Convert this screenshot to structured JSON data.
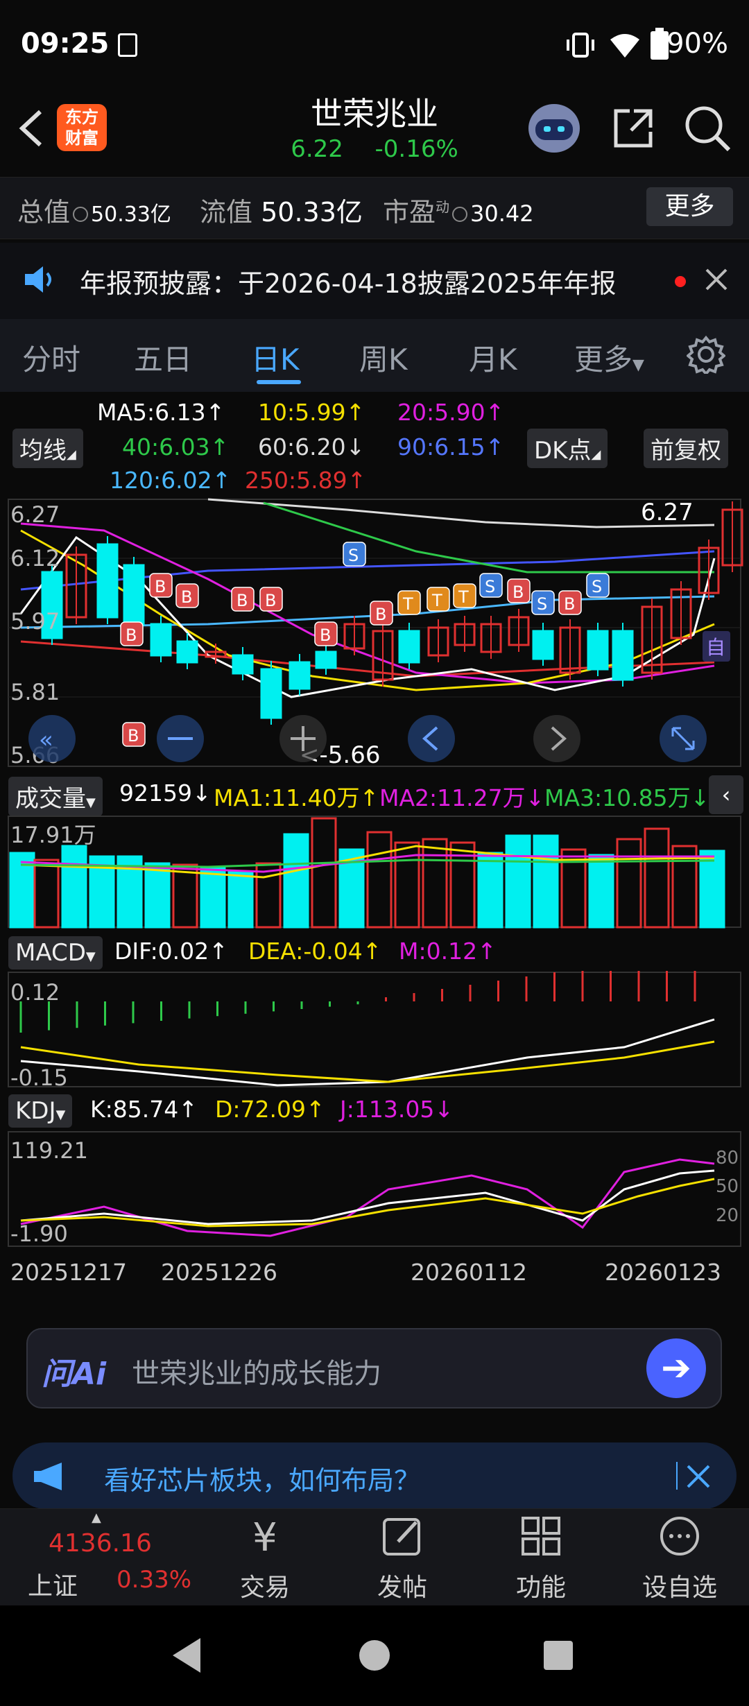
{
  "status": {
    "time": "09:25",
    "battery": "90%"
  },
  "header": {
    "logo_line1": "东方",
    "logo_line2": "财富",
    "title": "世荣兆业",
    "price": "6.22",
    "change": "-0.16%"
  },
  "info": {
    "total_label": "总值",
    "total_value": "50.33亿",
    "float_label": "流值",
    "float_value": "50.33亿",
    "pe_label": "市盈",
    "pe_sup": "动",
    "pe_value": "30.42",
    "more": "更多"
  },
  "notice": {
    "text": "年报预披露：于2026-04-18披露2025年年报"
  },
  "tabs": [
    "分时",
    "五日",
    "日K",
    "周K",
    "月K",
    "更多"
  ],
  "ma": {
    "button": "均线",
    "ma5": "MA5:6.13↑",
    "ma10": "10:5.99↑",
    "ma20": "20:5.90↑",
    "ma40": "40:6.03↑",
    "ma60": "60:6.20↓",
    "ma90": "90:6.15↑",
    "ma120": "120:6.02↑",
    "ma250": "250:5.89↑",
    "dk": "DK点",
    "fq": "前复权"
  },
  "kline": {
    "y_labels": [
      "6.27",
      "6.12",
      "5.97",
      "5.81",
      "5.66"
    ],
    "high_label": "6.27",
    "low_label": "<-5.66",
    "self_btn": "自"
  },
  "volume": {
    "label": "成交量",
    "value": "92159↓",
    "ma1": "MA1:11.40万↑",
    "ma2": "MA2:11.27万↓",
    "ma3": "MA3:10.85万↓",
    "y_label": "17.91万"
  },
  "macd": {
    "label": "MACD",
    "dif": "DIF:0.02↑",
    "dea": "DEA:-0.04↑",
    "m": "M:0.12↑",
    "y_top": "0.12",
    "y_bottom": "-0.15"
  },
  "kdj": {
    "label": "KDJ",
    "k": "K:85.74↑",
    "d": "D:72.09↑",
    "j": "J:113.05↓",
    "y_top": "119.21",
    "y_bottom": "-1.90",
    "right_80": "80",
    "right_50": "50",
    "right_20": "20"
  },
  "dates": [
    "20251217",
    "20251226",
    "20260112",
    "20260123"
  ],
  "ai": {
    "brand": "问Ai",
    "placeholder": "世荣兆业的成长能力"
  },
  "promo": {
    "text": "看好芯片板块，如何布局？"
  },
  "bottom_nav": {
    "index_value": "4136.16",
    "index_name": "上证",
    "index_change": "0.33%",
    "trade": "交易",
    "post": "发帖",
    "func": "功能",
    "watch": "设自选"
  },
  "colors": {
    "up": "#e03030",
    "down": "#00f0f0",
    "accent": "#4aa8ff",
    "green": "#2ec94a"
  }
}
